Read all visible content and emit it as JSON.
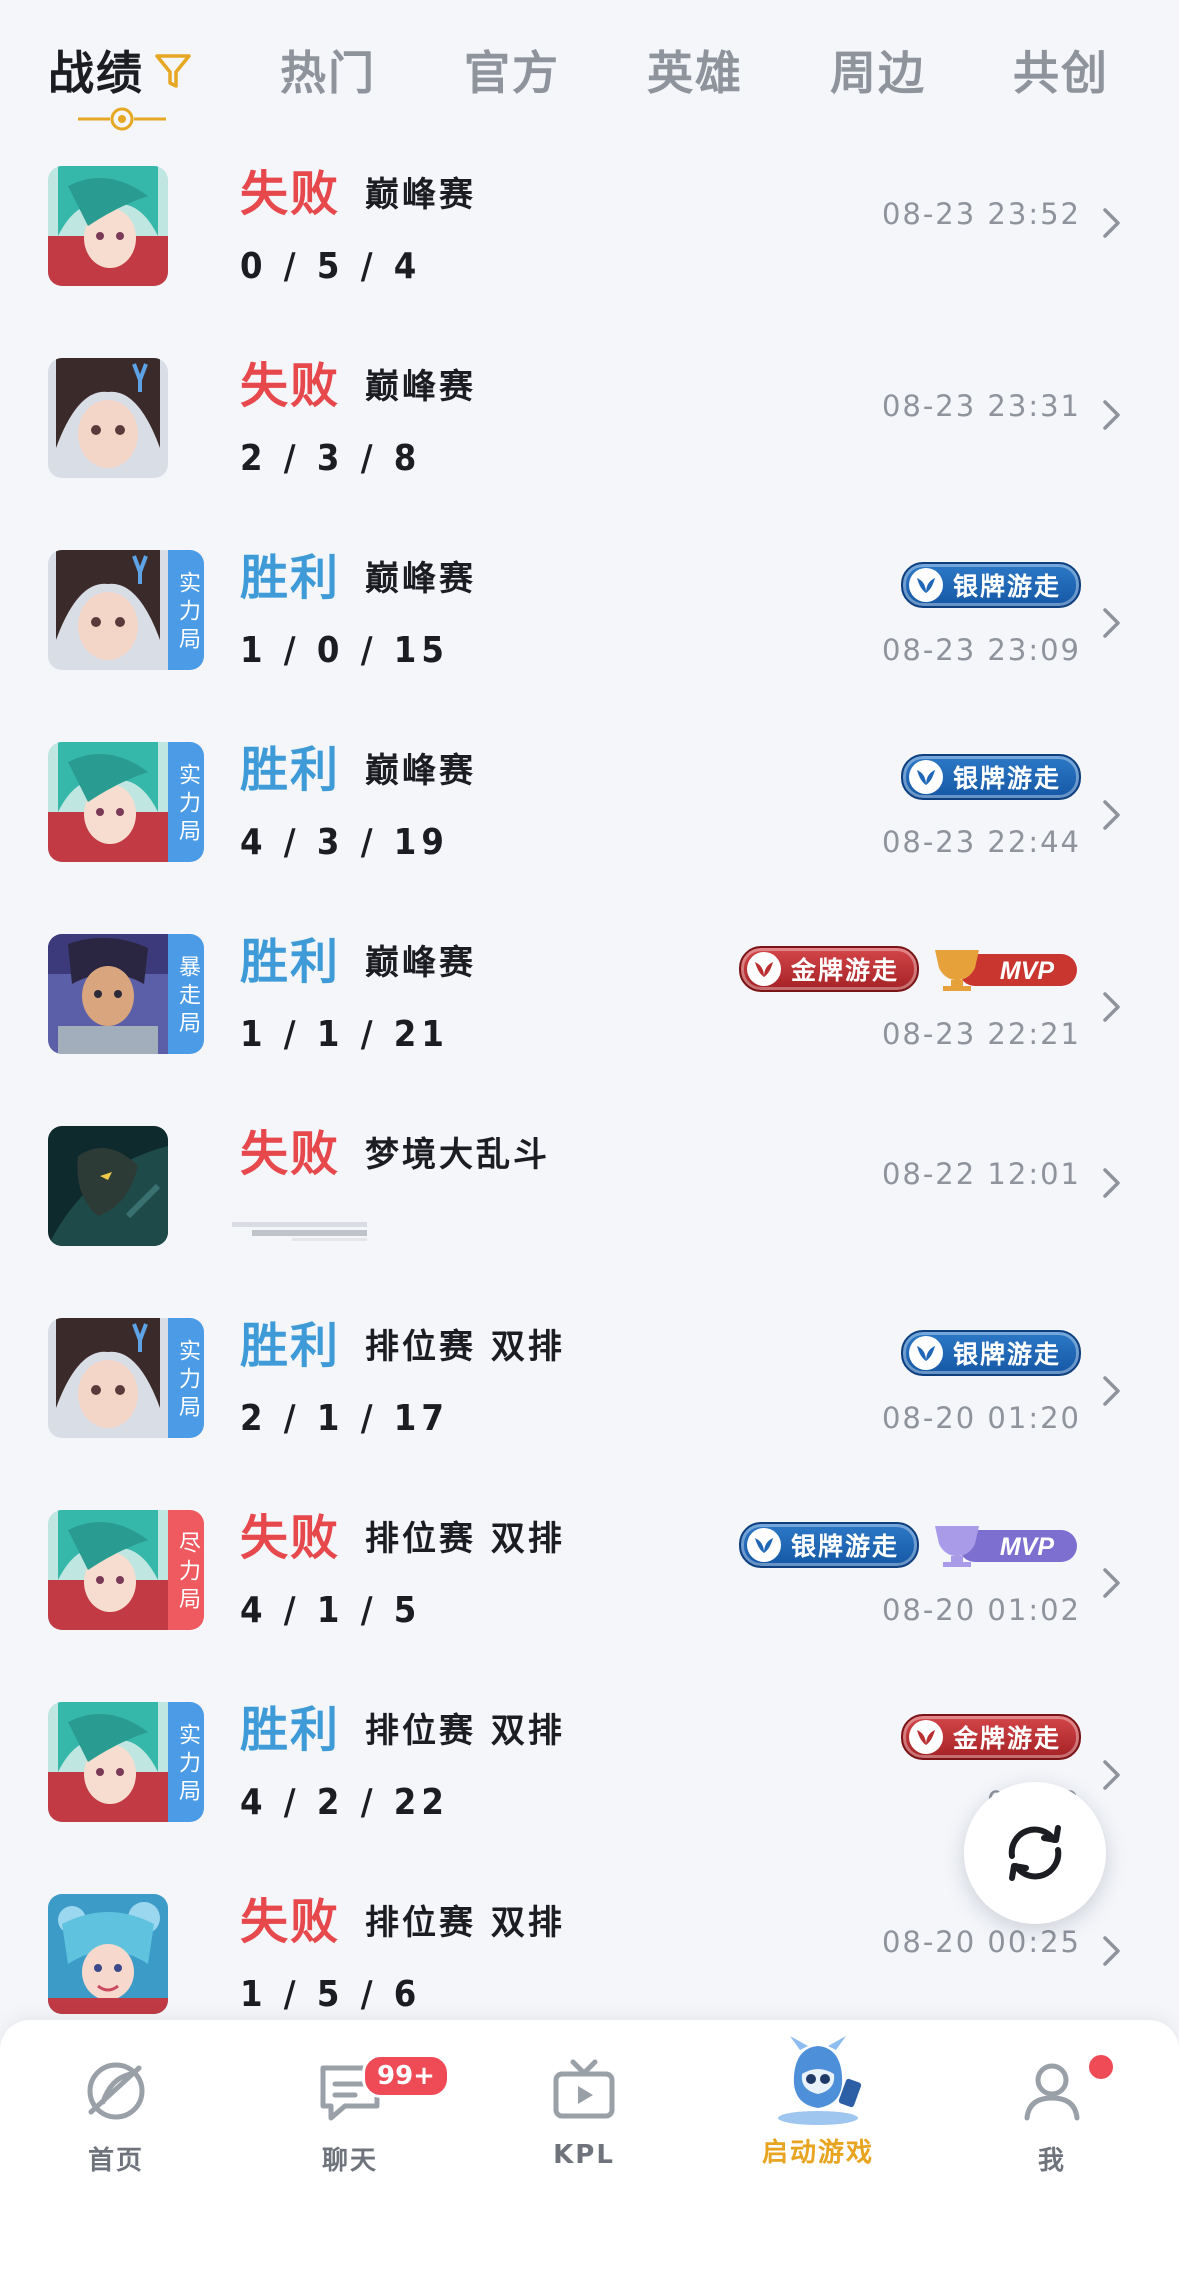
{
  "tabs": [
    {
      "label": "战绩",
      "active": true
    },
    {
      "label": "热门",
      "active": false
    },
    {
      "label": "官方",
      "active": false
    },
    {
      "label": "英雄",
      "active": false
    },
    {
      "label": "周边",
      "active": false
    },
    {
      "label": "共创",
      "active": false
    }
  ],
  "records": [
    {
      "result": "失败",
      "mode": "巅峰赛",
      "kda": "0 / 5 / 4",
      "time": "08-23 23:52",
      "tag": "",
      "badges": [],
      "hero": "teal-hair"
    },
    {
      "result": "失败",
      "mode": "巅峰赛",
      "kda": "2 / 3 / 8",
      "time": "08-23 23:31",
      "tag": "",
      "badges": [],
      "hero": "brown-hair"
    },
    {
      "result": "胜利",
      "mode": "巅峰赛",
      "kda": "1 / 0 / 15",
      "time": "08-23 23:09",
      "tag": "实力局",
      "badges": [
        "银牌游走"
      ],
      "hero": "brown-hair"
    },
    {
      "result": "胜利",
      "mode": "巅峰赛",
      "kda": "4 / 3 / 19",
      "time": "08-23 22:44",
      "tag": "实力局",
      "badges": [
        "银牌游走"
      ],
      "hero": "teal-hair"
    },
    {
      "result": "胜利",
      "mode": "巅峰赛",
      "kda": "1 / 1 / 21",
      "time": "08-23 22:21",
      "tag": "暴走局",
      "badges": [
        "金牌游走",
        "MVP"
      ],
      "hero": "armored-man"
    },
    {
      "result": "失败",
      "mode": "梦境大乱斗",
      "kda": "",
      "time": "08-22 12:01",
      "tag": "",
      "badges": [],
      "hero": "dark-knight"
    },
    {
      "result": "胜利",
      "mode": "排位赛 双排",
      "kda": "2 / 1 / 17",
      "time": "08-20 01:20",
      "tag": "实力局",
      "badges": [
        "银牌游走"
      ],
      "hero": "brown-hair"
    },
    {
      "result": "失败",
      "mode": "排位赛 双排",
      "kda": "4 / 1 / 5",
      "time": "08-20 01:02",
      "tag": "尽力局",
      "badges": [
        "银牌游走",
        "MVP"
      ],
      "hero": "teal-hair"
    },
    {
      "result": "胜利",
      "mode": "排位赛 双排",
      "kda": "4 / 2 / 22",
      "time": "08-20",
      "tag": "实力局",
      "badges": [
        "金牌游走"
      ],
      "hero": "teal-hair"
    },
    {
      "result": "失败",
      "mode": "排位赛 双排",
      "kda": "1 / 5 / 6",
      "time": "08-20 00:25",
      "tag": "",
      "badges": [],
      "hero": "blue-fairy"
    }
  ],
  "bottom_nav": [
    {
      "label": "首页",
      "icon": "home-icon"
    },
    {
      "label": "聊天",
      "icon": "chat-icon",
      "badge": "99+"
    },
    {
      "label": "KPL",
      "icon": "tv-icon"
    },
    {
      "label": "启动游戏",
      "icon": "launch-game-icon",
      "active": true
    },
    {
      "label": "我",
      "icon": "profile-icon",
      "dot": true
    }
  ],
  "colors": {
    "win": "#3f9bd8",
    "lose": "#e6484c",
    "accent": "#e8a41e",
    "silver_badge": "#1f67b6",
    "gold_badge": "#b92f32"
  }
}
